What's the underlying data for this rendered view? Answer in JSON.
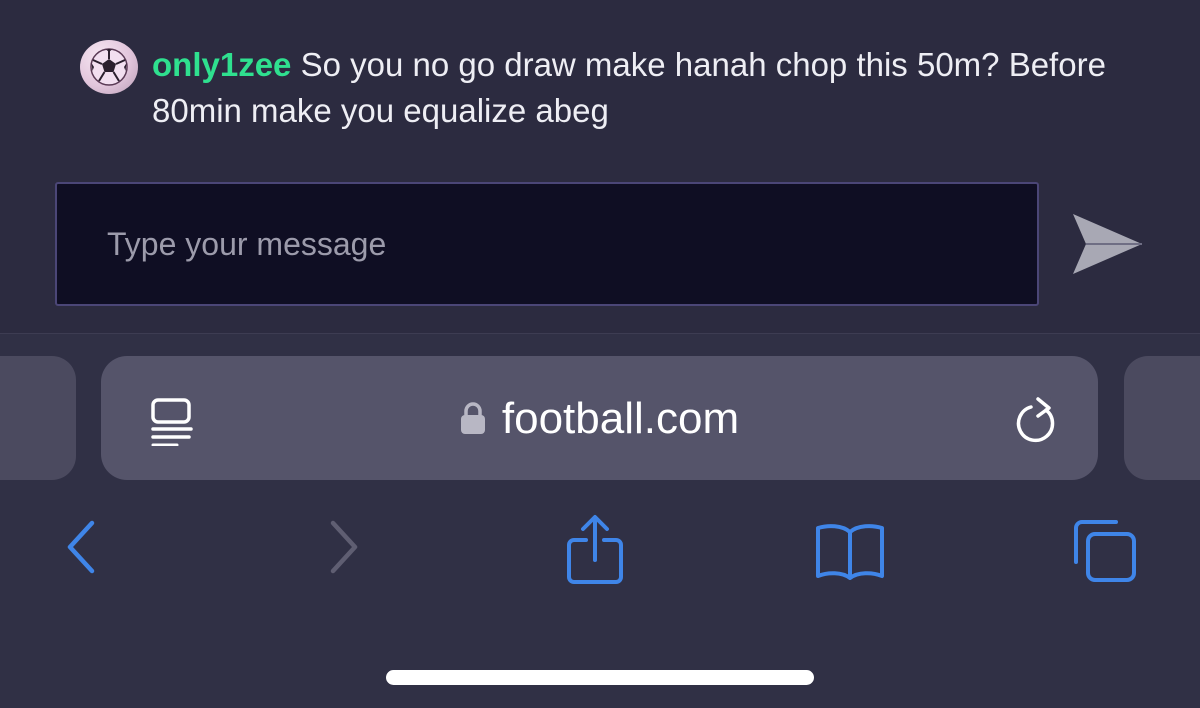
{
  "chat": {
    "username": "only1zee",
    "message": " So you no go draw make hanah chop this 50m? Before 80min make you equalize abeg",
    "avatar_icon": "soccer-ball-icon",
    "input_placeholder": "Type your message"
  },
  "browser": {
    "url": "football.com",
    "icons": [
      "reader-mode-icon",
      "lock-icon",
      "reload-icon",
      "back-icon",
      "forward-icon",
      "share-icon",
      "bookmarks-icon",
      "tabs-icon"
    ],
    "accent_color": "#3f85e8"
  },
  "colors": {
    "username": "#2fe08f",
    "chat_background": "#2c2b40",
    "input_background": "#0f0e23"
  }
}
